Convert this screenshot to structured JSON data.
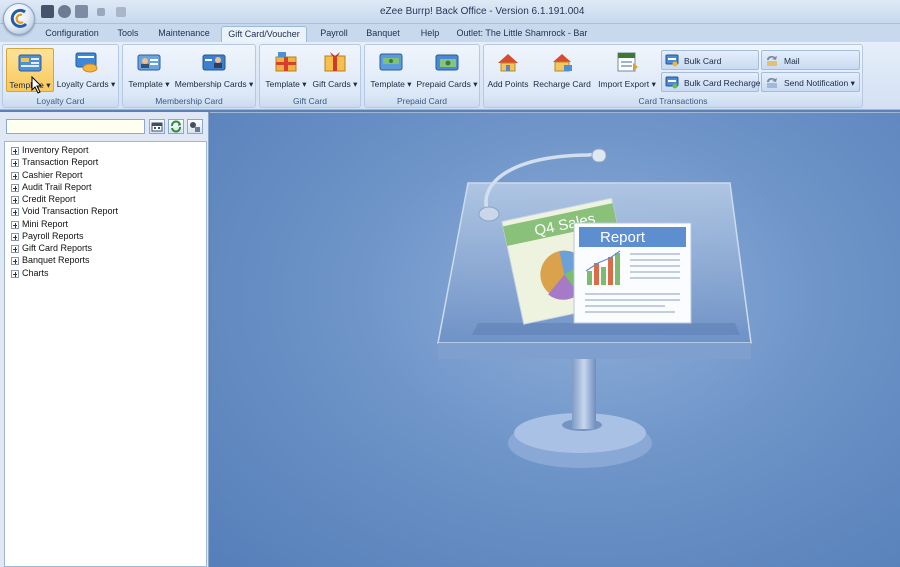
{
  "window": {
    "title": "eZee Burrp! Back Office - Version 6.1.191.004"
  },
  "tabs": [
    {
      "label": "Configuration",
      "active": false
    },
    {
      "label": "Tools",
      "active": false
    },
    {
      "label": "Maintenance",
      "active": false
    },
    {
      "label": "Gift Card/Voucher",
      "active": true
    },
    {
      "label": "Payroll",
      "active": false
    },
    {
      "label": "Banquet",
      "active": false
    },
    {
      "label": "Help",
      "active": false
    }
  ],
  "outlet": "Outlet: The Little Shamrock - Bar",
  "ribbon": {
    "groups": {
      "loyalty": {
        "label": "Loyalty Card",
        "buttons": [
          "Template",
          "Loyalty Cards"
        ]
      },
      "membership": {
        "label": "Membership Card",
        "buttons": [
          "Template",
          "Membership Cards"
        ]
      },
      "gift": {
        "label": "Gift Card",
        "buttons": [
          "Template",
          "Gift Cards"
        ]
      },
      "prepaid": {
        "label": "Prepaid Card",
        "buttons": [
          "Template",
          "Prepaid Cards"
        ]
      },
      "transactions": {
        "label": "Card Transactions",
        "buttons": [
          "Add Points",
          "Recharge Card",
          "Import Export"
        ],
        "small_buttons": [
          "Bulk Card",
          "Bulk Card Recharge",
          "Mail",
          "Send Notification"
        ]
      }
    }
  },
  "dropdown_arrow": "▾",
  "tree_items": [
    "Inventory Report",
    "Transaction Report",
    "Cashier Report",
    "Audit Trail Report",
    "Credit Report",
    "Void Transaction Report",
    "Mini Report",
    "Payroll Reports",
    "Gift Card Reports",
    "Banquet Reports",
    "Charts"
  ],
  "illustration": {
    "sheet1_title": "Q4 Sales",
    "sheet2_title": "Report"
  },
  "colors": {
    "accent": "#f9c85a",
    "ribbon": "#dce8f7",
    "background": "#5a82b8"
  }
}
